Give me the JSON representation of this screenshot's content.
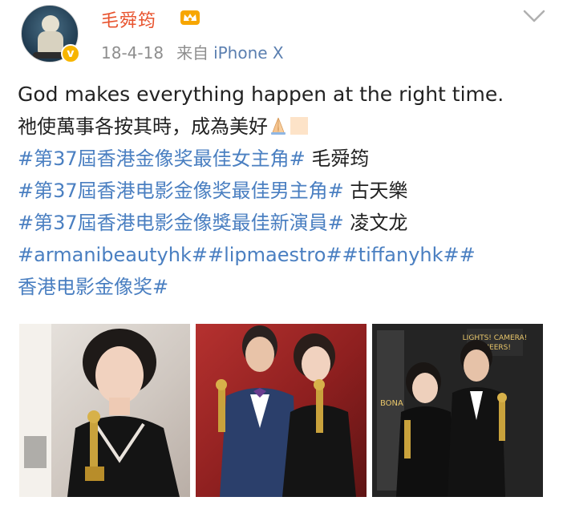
{
  "post": {
    "author_name": "毛舜筠",
    "date": "18-4-18",
    "source_prefix": "来自",
    "source_device": "iPhone X",
    "crown_icon": "crown-icon",
    "verified_icon": "verified-badge-icon",
    "menu_icon": "chevron-down-icon"
  },
  "content": {
    "line1": "God makes everything happen at the right time.",
    "line2": "祂使萬事各按其時，成為美好",
    "line3_tag": "#第37屆香港金像奖最佳女主角#",
    "line3_text": " 毛舜筠",
    "line4_tag": "#第37屆香港电影金像奖最佳男主角#",
    "line4_text": " 古天樂",
    "line5_tag": "#第37屆香港电影金像獎最佳新演員#",
    "line5_text": " 凌文龙",
    "line6_tags": "#armanibeautyhk##lipmaestro##tiffanyhk##",
    "line7_tag": "香港电影金像奖#",
    "emoji": "pray-emoji"
  },
  "photos": [
    {
      "name": "award-photo-1"
    },
    {
      "name": "award-photo-2"
    },
    {
      "name": "award-photo-3",
      "backdrop_texts": [
        "LIGHTS! CAMERA! CHEERS!",
        "BONA"
      ]
    }
  ],
  "colors": {
    "username": "#e8532e",
    "hashtag": "#4a7fc1",
    "meta": "#8e8e8e",
    "device": "#5b7fb0"
  }
}
